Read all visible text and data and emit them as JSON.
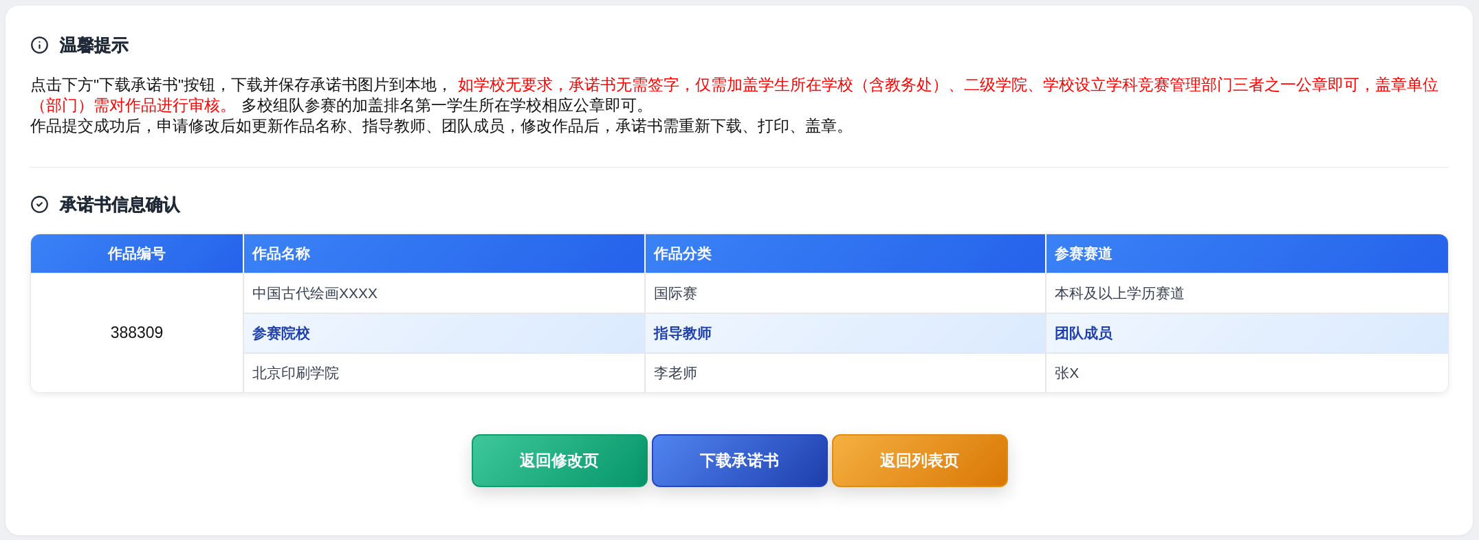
{
  "notice": {
    "title": "温馨提示",
    "paragraphs": [
      {
        "segments": [
          {
            "text": "点击下方\"下载承诺书\"按钮，下载并保存承诺书图片到本地，",
            "highlighted": false
          },
          {
            "text": "如学校无要求，承诺书无需签字，仅需加盖学生所在学校（含教务处）、二级学院、学校设立学科竞赛管理部门三者之一公章即可，盖章单位（部门）需对作品进行审核。",
            "highlighted": true
          },
          {
            "text": "多校组队参赛的加盖排名第一学生所在学校相应公章即可。",
            "highlighted": false
          }
        ]
      },
      {
        "segments": [
          {
            "text": "作品提交成功后，申请修改后如更新作品名称、指导教师、团队成员，修改作品后，承诺书需重新下载、打印、盖章。",
            "highlighted": false
          }
        ]
      }
    ]
  },
  "confirmation": {
    "title": "承诺书信息确认",
    "table": {
      "columns": [
        "作品编号",
        "作品名称",
        "作品分类",
        "参赛赛道"
      ],
      "rows": [
        {
          "kind": "value",
          "cells": [
            "",
            "中国古代绘画XXXX",
            "国际赛",
            "本科及以上学历赛道"
          ]
        },
        {
          "kind": "label",
          "cells": [
            "388309",
            "参赛院校",
            "指导教师",
            "团队成员"
          ]
        },
        {
          "kind": "value",
          "cells": [
            "",
            "北京印刷学院",
            "李老师",
            "张X"
          ]
        }
      ]
    }
  },
  "buttons": [
    {
      "label": "返回修改页",
      "kind": "success"
    },
    {
      "label": "下载承诺书",
      "kind": "primary"
    },
    {
      "label": "返回列表页",
      "kind": "warning"
    }
  ]
}
